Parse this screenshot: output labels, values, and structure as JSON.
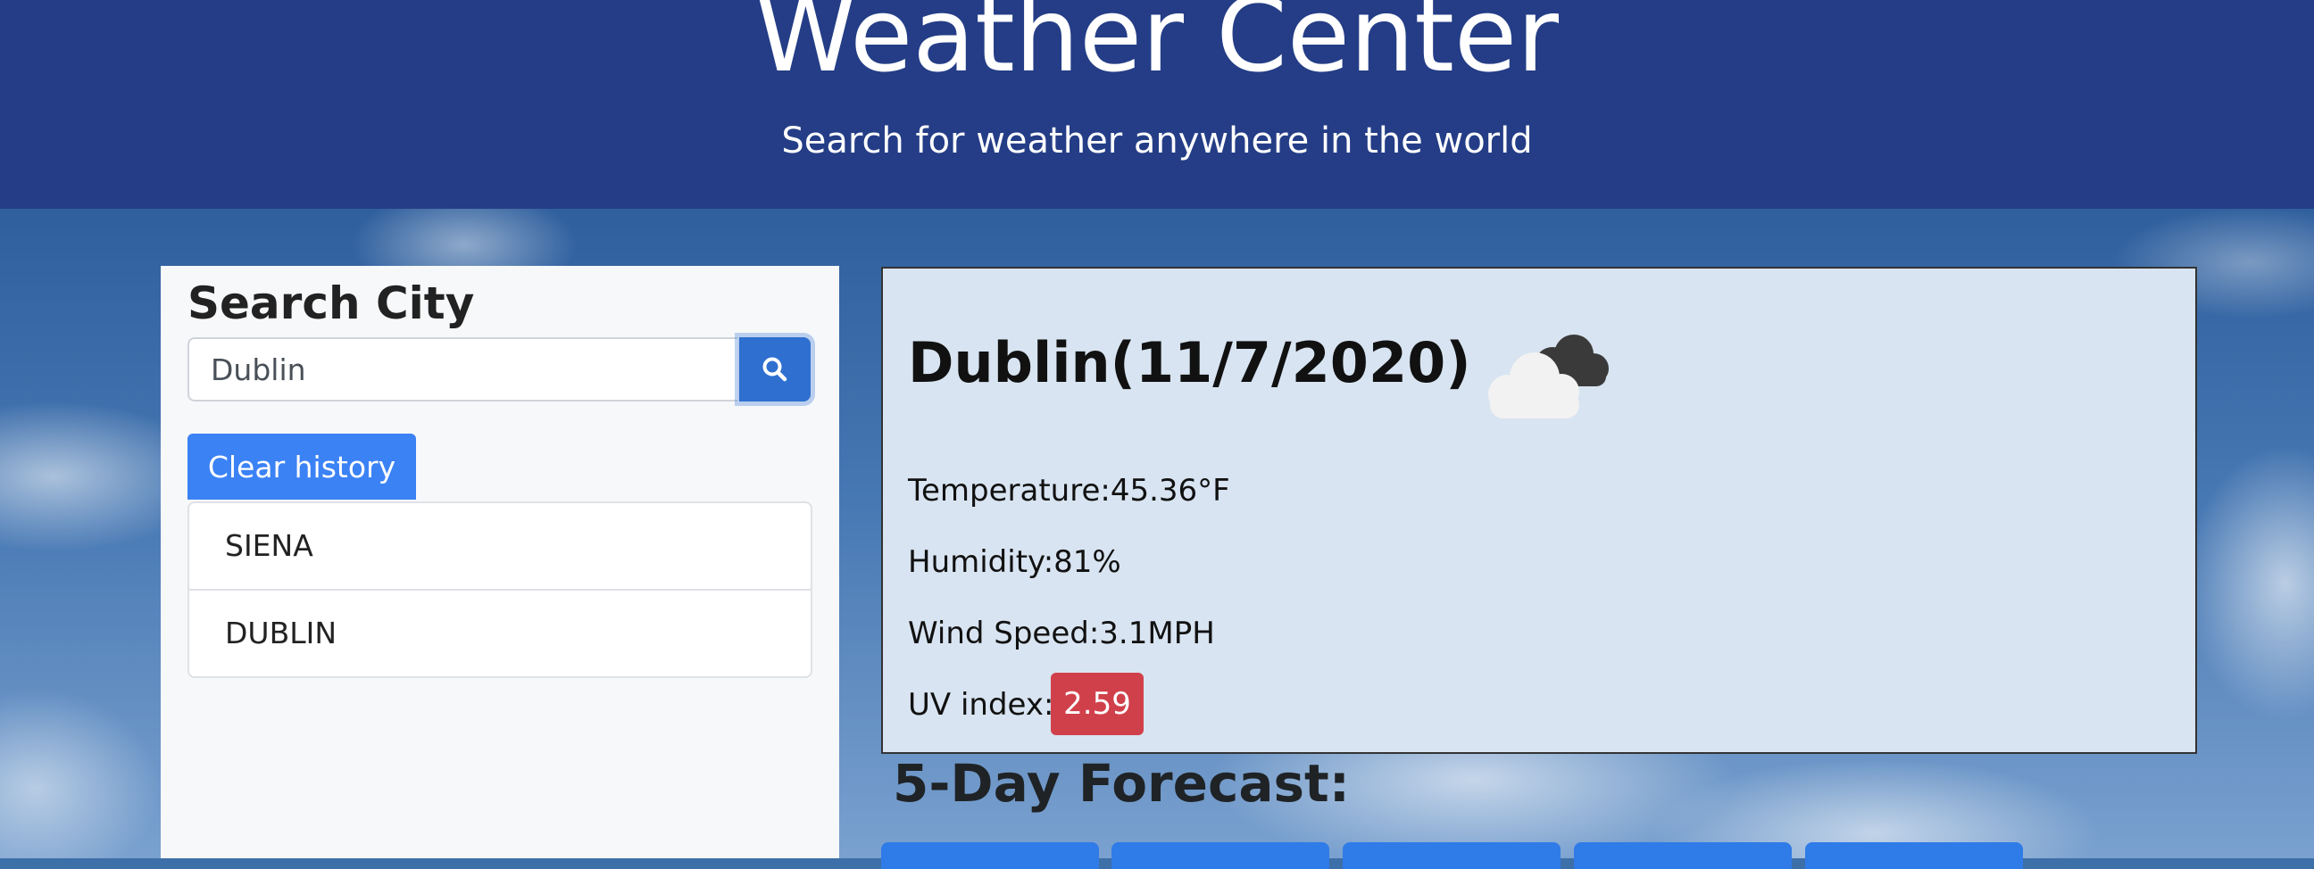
{
  "header": {
    "title": "Weather Center",
    "subtitle": "Search for weather anywhere in the world"
  },
  "search": {
    "heading": "Search City",
    "input_value": "Dublin",
    "button_icon": "search-icon",
    "clear_label": "Clear history",
    "history": [
      "SIENA",
      "DUBLIN"
    ]
  },
  "current": {
    "heading": "Dublin(11/7/2020)",
    "icon": "cloudy-icon",
    "temperature": "Temperature:45.36°F",
    "humidity": "Humidity:81%",
    "wind": "Wind Speed:3.1MPH",
    "uv_label": "UV index:",
    "uv_value": "2.59"
  },
  "forecast": {
    "heading": "5-Day Forecast:",
    "cards": [
      "",
      "",
      "",
      "",
      ""
    ]
  },
  "colors": {
    "header_bg": "#243d86",
    "primary": "#3b82f5",
    "uv_badge": "#d0404a",
    "card_bg": "#d8e4f1"
  }
}
